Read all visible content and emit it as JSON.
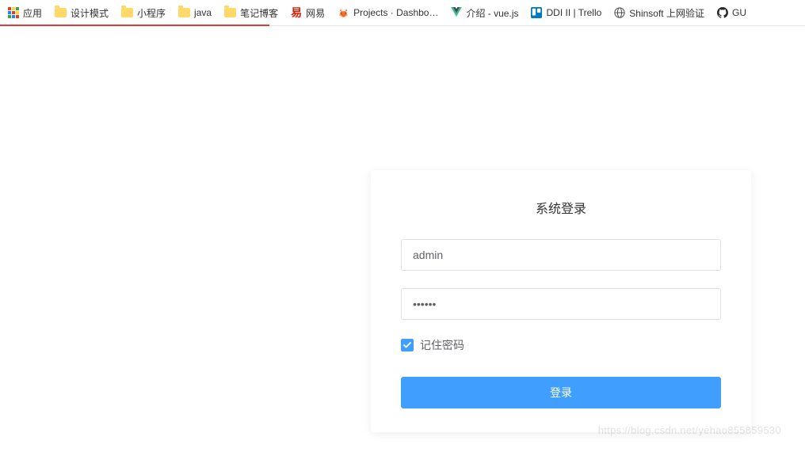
{
  "bookmarks": {
    "apps": "应用",
    "items": [
      {
        "label": "设计模式",
        "type": "folder"
      },
      {
        "label": "小程序",
        "type": "folder"
      },
      {
        "label": "java",
        "type": "folder"
      },
      {
        "label": "笔记博客",
        "type": "folder"
      },
      {
        "label": "网易",
        "type": "netease"
      },
      {
        "label": "Projects · Dashbo…",
        "type": "gitlab"
      },
      {
        "label": "介绍 - vue.js",
        "type": "vue"
      },
      {
        "label": "DDI II | Trello",
        "type": "trello"
      },
      {
        "label": "Shinsoft 上网验证",
        "type": "globe"
      },
      {
        "label": "GU",
        "type": "github"
      }
    ]
  },
  "login": {
    "title": "系统登录",
    "username_value": "admin",
    "password_value": "••••••",
    "remember_label": "记住密码",
    "remember_checked": true,
    "submit_label": "登录"
  },
  "watermark": "https://blog.csdn.net/yehao855859530",
  "colors": {
    "primary": "#409eff",
    "progress": "#e53935"
  }
}
